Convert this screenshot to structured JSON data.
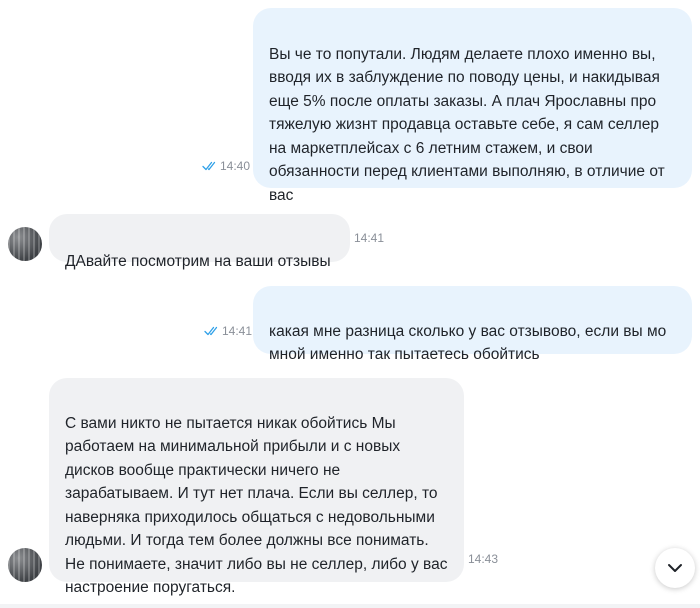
{
  "chat": {
    "messages": [
      {
        "direction": "outgoing",
        "text": "Вы че то попутали. Людям делаете плохо именно вы, вводя их в заблуждение по поводу цены, и накидывая еще 5% после оплаты заказы. А плач Ярославны про тяжелую жизнт продавца оставьте себе, я сам селлер на маркетплейсах с 6 летним стажем, и свои обязанности перед клиентами выполняю, в отличие от вас",
        "time": "14:40",
        "read": true
      },
      {
        "direction": "incoming",
        "text": "ДАвайте посмотрим на ваши отзывы",
        "time": "14:41"
      },
      {
        "direction": "outgoing",
        "text": "какая мне разница сколько у вас отзывово, если вы мо мной именно так пытаетесь обойтись",
        "time": "14:41",
        "read": true
      },
      {
        "direction": "incoming",
        "text": "С вами никто не пытается никак обойтись Мы работаем на минимальной прибыли и с новых дисков вообще практически ничего не зарабатываем. И тут нет плача. Если вы селлер, то наверняка приходилось общаться с недовольными людьми. И тогда тем более должны все понимать. Не понимаете, значит либо вы не селлер, либо у вас настроение поругаться.",
        "time": "14:43"
      }
    ]
  },
  "icons": {
    "read_receipt": "double-check-icon",
    "scroll_down": "chevron-down-icon",
    "avatar": "avatar"
  },
  "colors": {
    "outgoing_bubble": "#e8f3fd",
    "incoming_bubble": "#f0f1f3",
    "read_check": "#2fa0e8",
    "meta_text": "#8a8f98"
  }
}
